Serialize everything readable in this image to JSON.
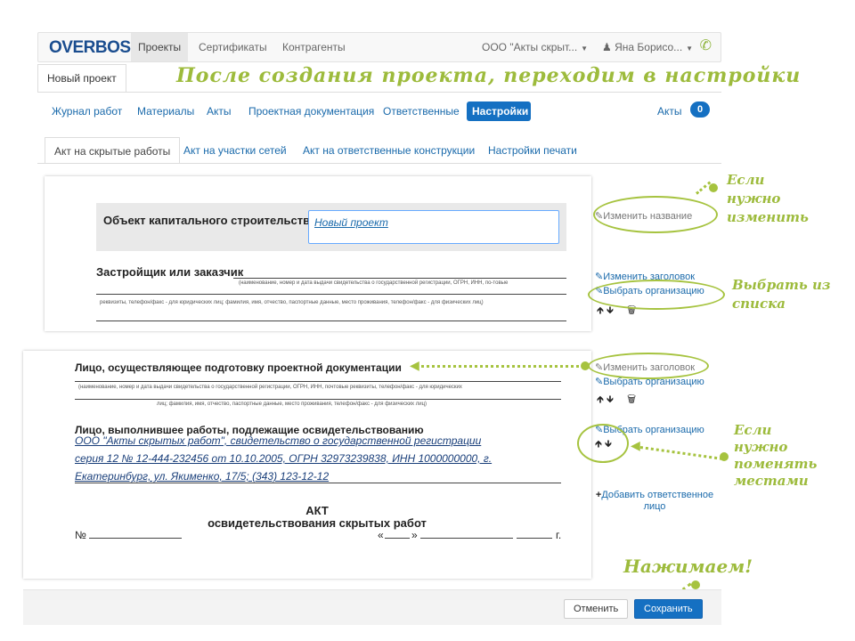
{
  "app": {
    "logo": "OVERBOSS"
  },
  "topnav": {
    "items": [
      "Проекты",
      "Сертификаты",
      "Контрагенты"
    ],
    "company": "ООО \"Акты скрыт...",
    "user": "Яна Борисо..."
  },
  "project_tab": "Новый проект",
  "annotations": {
    "title": "После создания проекта, переходим в настройки",
    "if_rename": "Если\nнужно\nизменить",
    "choose_from_list": "Выбрать из\nсписка",
    "if_swap": "Если\nнужно\nпоменять\nместами",
    "press": "Нажимаем!"
  },
  "nav_pills": {
    "items": [
      "Журнал работ",
      "Материалы",
      "Акты",
      "Проектная документация",
      "Ответственные",
      "Настройки"
    ],
    "active": "Настройки",
    "acts_label": "Акты",
    "acts_count": "0"
  },
  "subtabs": [
    "Акт на скрытые работы",
    "Акт на участки сетей",
    "Акт на ответственные конструкции",
    "Настройки печати"
  ],
  "doc1": {
    "object_label": "Объект капитального строительства",
    "object_value": "Новый проект",
    "builder_label": "Застройщик или заказчик",
    "builder_hint1": "(наименование, номер и дата выдачи свидетельства о государственной регистрации, ОГРН, ИНН, по-товые",
    "builder_hint2": "реквизиты, телефон/факс - для юридических лиц; фамилия, имя, отчество, паспортные данные, место проживания, телефон/факс - для физических лиц)"
  },
  "doc2": {
    "design_label": "Лицо, осуществляющее подготовку проектной документации",
    "design_hint1": "(наименование, номер и дата выдачи свидетельства о государственной регистрации, ОГРН, ИНН, почтовые реквизиты, телефон/факс - для юридических",
    "design_hint2": "лиц; фамилия, имя, отчество, паспортные данные, место проживания, телефон/факс - для физических лиц)",
    "contractor_label": "Лицо, выполнившее работы, подлежащие освидетельствованию",
    "contractor_line1": "ООО \"Акты скрытых работ\", свидетельство о государственной регистрации",
    "contractor_line2": "серия 12 № 12-444-232456 от 10.10.2005, ОГРН 32973239838, ИНН 1000000000, г.",
    "contractor_line3": "Екатеринбург, ул. Якименко, 17/5; (343) 123-12-12",
    "act_title1": "АКТ",
    "act_title2": "освидетельствования скрытых работ",
    "number_label": "№",
    "date_open": "«",
    "date_close": "»",
    "year_suffix": "г."
  },
  "side_links": {
    "rename": "Изменить название",
    "change_header": "Изменить заголовок",
    "choose_org": "Выбрать организацию",
    "add_responsible": "Добавить ответственное лицо"
  },
  "footer": {
    "cancel": "Отменить",
    "save": "Сохранить"
  }
}
